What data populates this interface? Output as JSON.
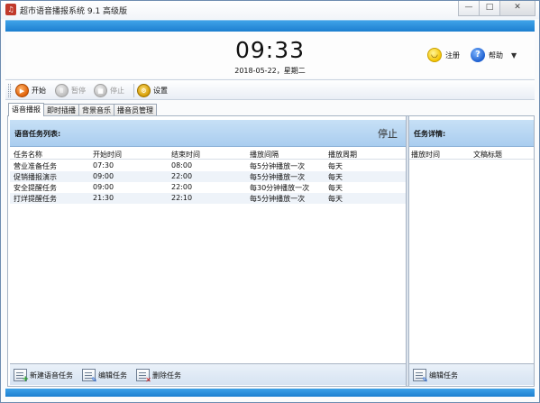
{
  "window": {
    "title": "超市语音播报系统 9.1 高级版",
    "app_icon_glyph": "♫",
    "buttons": {
      "minimize": "—",
      "maximize": "□",
      "close": "✕"
    }
  },
  "header": {
    "time": "09:33",
    "date": "2018-05-22，星期二",
    "register_label": "注册",
    "help_label": "帮助",
    "help_glyph": "?",
    "dropdown_glyph": "▼"
  },
  "toolbar": {
    "start_label": "开始",
    "pause_label": "暂停",
    "stop_label": "停止",
    "settings_label": "设置",
    "start_glyph": "▶",
    "pause_glyph": "Ⅱ",
    "stop_glyph": "■",
    "settings_glyph": "⚙"
  },
  "tabs": [
    "语音播报",
    "即时插播",
    "背景音乐",
    "播音员管理"
  ],
  "task_panel": {
    "title": "语音任务列表:",
    "status": "停止",
    "columns": [
      "任务名称",
      "开始时间",
      "结束时间",
      "播放间隔",
      "播放周期"
    ],
    "rows": [
      [
        "营业准备任务",
        "07:30",
        "08:00",
        "每5分钟播放一次",
        "每天"
      ],
      [
        "促销播报演示",
        "09:00",
        "22:00",
        "每5分钟播放一次",
        "每天"
      ],
      [
        "安全提醒任务",
        "09:00",
        "22:00",
        "每30分钟播放一次",
        "每天"
      ],
      [
        "打烊提醒任务",
        "21:30",
        "22:10",
        "每5分钟播放一次",
        "每天"
      ]
    ],
    "buttons": {
      "new": "新建语音任务",
      "edit": "编辑任务",
      "delete": "删除任务"
    }
  },
  "detail_panel": {
    "title": "任务详情:",
    "columns": [
      "播放时间",
      "文稿标题"
    ],
    "buttons": {
      "edit": "编辑任务"
    }
  },
  "colors": {
    "accent_blue": "#1d7fd0",
    "panel_header": "#b9d7f3",
    "row_alt": "#eef3f9"
  },
  "icons": {
    "register": "smiley-icon",
    "help": "help-icon",
    "start": "play-icon",
    "pause": "pause-icon",
    "stop": "stop-icon",
    "settings": "settings-icon",
    "new_task": "new-task-icon",
    "edit_task": "edit-task-icon",
    "delete_task": "delete-task-icon"
  }
}
